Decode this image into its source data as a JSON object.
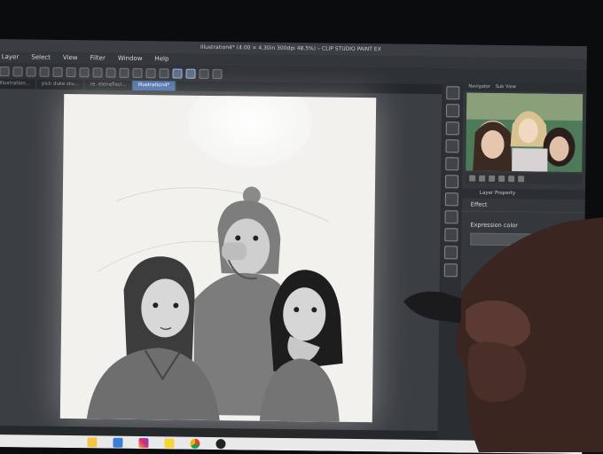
{
  "window": {
    "title": "Illustration4* (4.00 × 4.30in 300dpi 48.5%) – CLIP STUDIO PAINT EX"
  },
  "menu": [
    "Layer",
    "Select",
    "View",
    "Filter",
    "Window",
    "Help"
  ],
  "tabs": [
    {
      "label": "Illustration..."
    },
    {
      "label": "pick duke stu..."
    },
    {
      "label": "re. elenefleci..."
    },
    {
      "label": "Illustration4*",
      "active": true
    }
  ],
  "panel": {
    "navigator_tabs": [
      "Navigator",
      "Sub View"
    ],
    "layer_property_label": "Layer Property",
    "effect_label": "Effect",
    "expression_color_label": "Expression color"
  },
  "taskbar_icons": [
    "file-explorer-icon",
    "mail-icon",
    "instagram-icon",
    "sticky-notes-icon",
    "chrome-icon",
    "clip-studio-icon"
  ],
  "colors": {
    "ui_dark": "#2a2d31",
    "accent": "#4a6ea9",
    "canvas": "#f2f1ee"
  }
}
